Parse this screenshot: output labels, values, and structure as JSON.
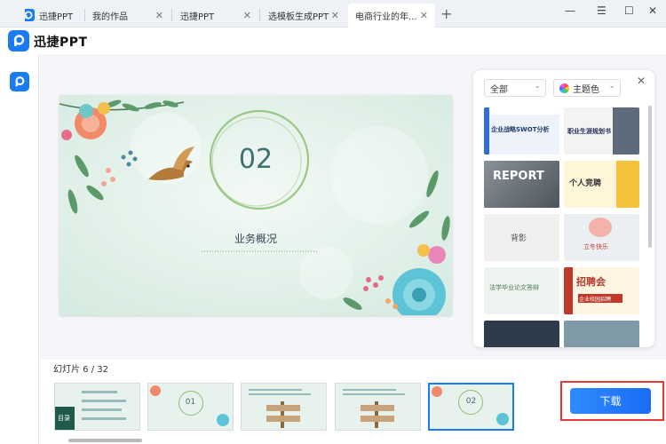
{
  "tabs": [
    {
      "label": "迅捷PPT"
    },
    {
      "label": "我的作品"
    },
    {
      "label": "迅捷PPT"
    },
    {
      "label": "选模板生成PPT"
    },
    {
      "label": "电商行业的年..."
    }
  ],
  "window_controls": {
    "minimize": "—",
    "maximize": "☐",
    "close": "✕"
  },
  "app": {
    "name": "迅捷PPT"
  },
  "slide": {
    "number": "02",
    "title": "业务概况"
  },
  "template_panel": {
    "filter_all": "全部",
    "filter_theme": "主题色",
    "templates": [
      {
        "title": "企业战略SWOT分析"
      },
      {
        "title": "职业生涯规划书"
      },
      {
        "title": "REPORT"
      },
      {
        "title": "个人竞聘"
      },
      {
        "title": "背影"
      },
      {
        "title": "立冬快乐"
      },
      {
        "title": "法学毕业论文答辩"
      },
      {
        "title": "招聘会"
      },
      {
        "title": "企业校园招聘"
      },
      {
        "title": ""
      },
      {
        "title": ""
      }
    ]
  },
  "thumbnails": {
    "label": "幻灯片 6 / 32",
    "items": [
      {
        "text": "目录"
      },
      {
        "text": "01"
      },
      {
        "text": ""
      },
      {
        "text": ""
      },
      {
        "text": "02"
      }
    ]
  },
  "download": {
    "label": "下载"
  },
  "colors": {
    "accent": "#1a7cf5",
    "highlight_border": "#e53935"
  }
}
